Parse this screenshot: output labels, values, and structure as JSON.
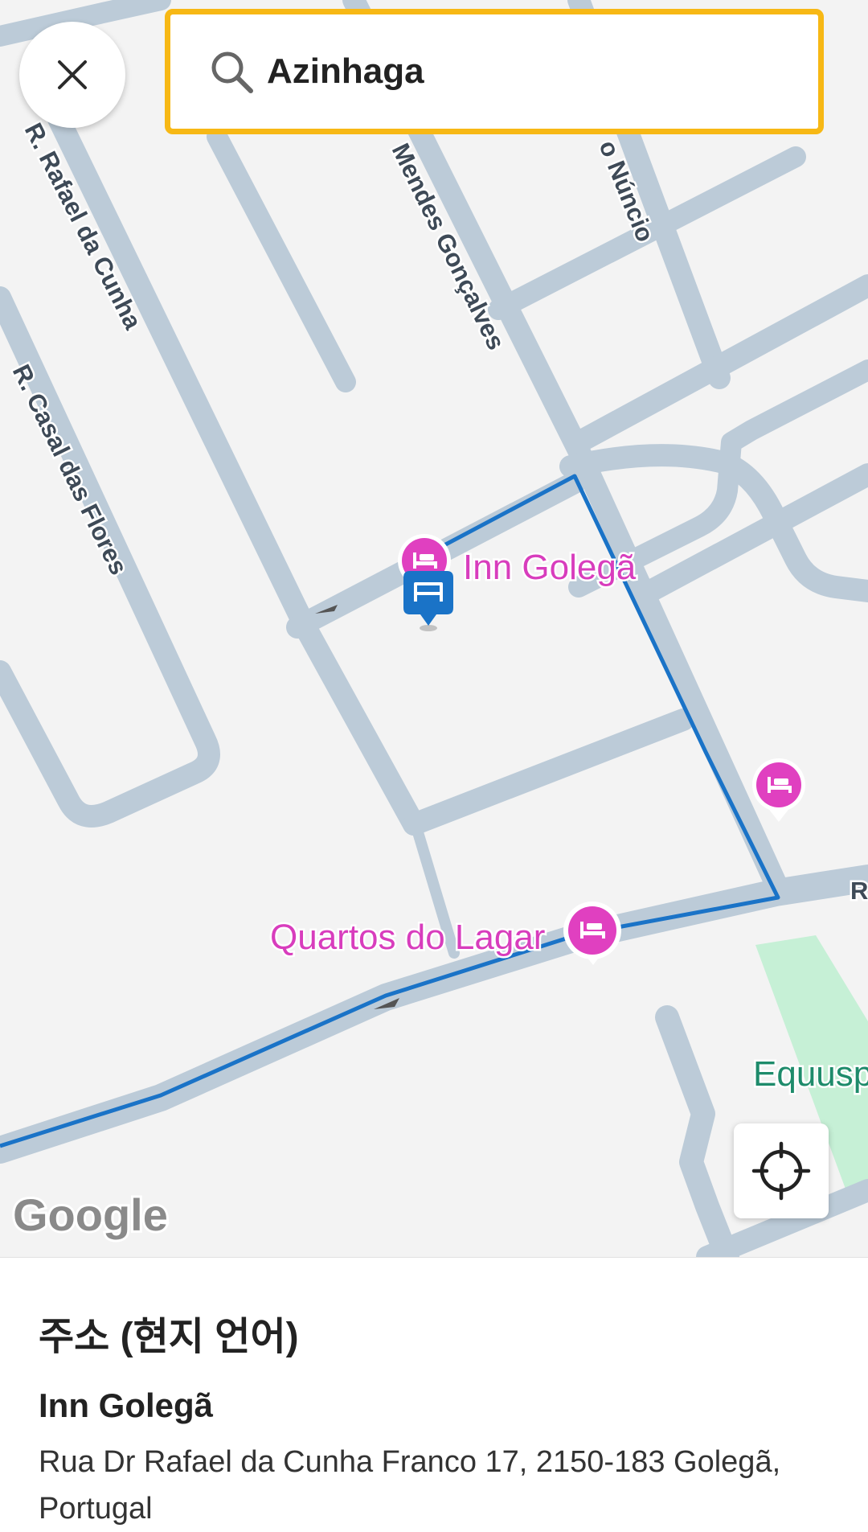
{
  "search": {
    "value": "Azinhaga"
  },
  "map": {
    "streets": [
      "R. Rafael da Cunha",
      "R. Casal das Flores",
      "Mendes Gonçalves",
      "o Núncio",
      "R"
    ],
    "pois": [
      "Inn Golegã",
      "Quartos do Lagar"
    ],
    "park_label": "Equusp",
    "logo": "Google",
    "colors": {
      "road": "#bccbd8",
      "route": "#1a73c7",
      "poi": "#e040c0",
      "selected_marker": "#1a73c7",
      "park": "#c6f0d6",
      "search_border": "#f7b815"
    }
  },
  "icons": {
    "close": "close-icon",
    "search": "search-icon",
    "locate": "my-location-icon",
    "hotel": "hotel-bed-icon"
  },
  "panel": {
    "title": "주소 (현지 언어)",
    "name": "Inn Golegã",
    "address": "Rua Dr Rafael da Cunha Franco 17, 2150-183 Golegã, Portugal"
  }
}
